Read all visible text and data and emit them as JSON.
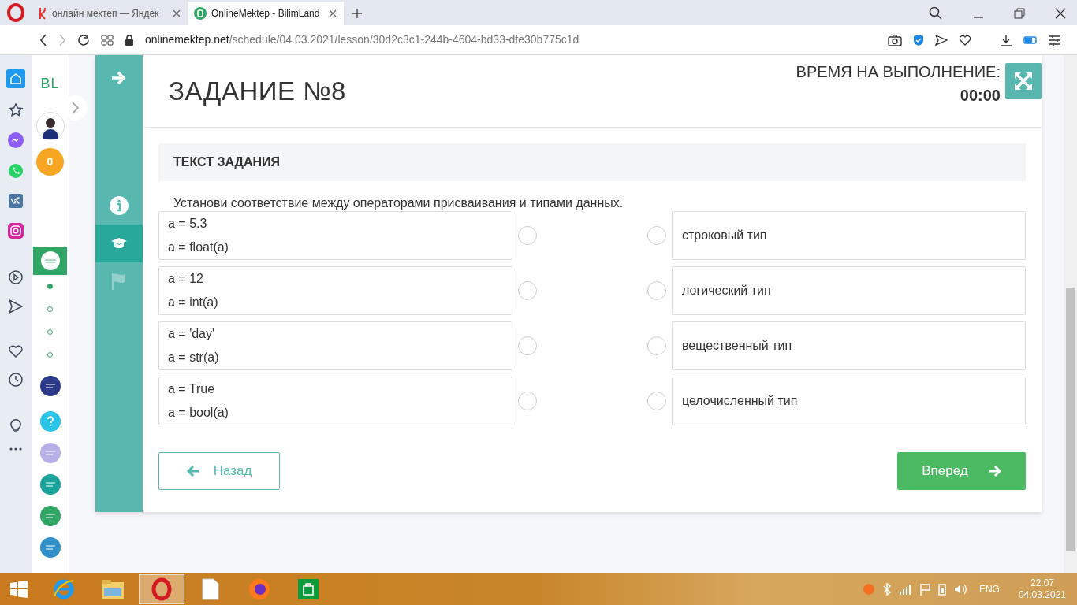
{
  "browser": {
    "tabs": [
      {
        "title": "онлайн мектеп — Яндек",
        "selected": false
      },
      {
        "title": "OnlineMektep - BilimLand",
        "selected": true
      }
    ],
    "address": {
      "host": "onlinemektep.net",
      "path": "/schedule/04.03.2021/lesson/30d2c3c1-244b-4604-bd33-dfe30b775c1d"
    }
  },
  "site_sidebar": {
    "logo": "BL",
    "points": "0",
    "pages": [
      {
        "selected": true
      },
      {
        "selected": false
      },
      {
        "selected": false
      },
      {
        "selected": false
      }
    ]
  },
  "lesson_nav": [
    {
      "kind": "info",
      "selected": false,
      "disabled": false
    },
    {
      "kind": "lessons",
      "selected": true,
      "disabled": false
    },
    {
      "kind": "flag",
      "selected": false,
      "disabled": true
    }
  ],
  "task": {
    "title": "ЗАДАНИЕ №8",
    "timer_label": "ВРЕМЯ НА ВЫПОЛНЕНИЕ:",
    "timer": "00:00",
    "section_title": "ТЕКСТ ЗАДАНИЯ",
    "instruction": "Установи соответствие между операторами присваивания и типами данных.",
    "left_items": [
      {
        "lines": [
          "a = 5.3",
          "a = float(a)"
        ],
        "selected": false
      },
      {
        "lines": [
          "a = 12",
          "a = int(a)"
        ],
        "selected": false
      },
      {
        "lines": [
          "a = 'day'",
          "a = str(a)"
        ],
        "selected": false
      },
      {
        "lines": [
          "a = True",
          "a = bool(a)"
        ],
        "selected": false
      }
    ],
    "right_items": [
      {
        "text": "строковый тип",
        "selected": false
      },
      {
        "text": "логический тип",
        "selected": false
      },
      {
        "text": "вещественный тип",
        "selected": false
      },
      {
        "text": "целочисленный тип",
        "selected": false
      }
    ],
    "back_button": "Назад",
    "next_button": "Вперед"
  },
  "taskbar": {
    "apps": [
      {
        "kind": "ie",
        "selected": false
      },
      {
        "kind": "explorer",
        "selected": false
      },
      {
        "kind": "opera",
        "selected": true
      },
      {
        "kind": "file",
        "selected": false
      },
      {
        "kind": "firefox",
        "selected": false
      },
      {
        "kind": "store",
        "selected": false
      }
    ],
    "language": "ENG",
    "time": "22:07",
    "date": "04.03.2021"
  }
}
